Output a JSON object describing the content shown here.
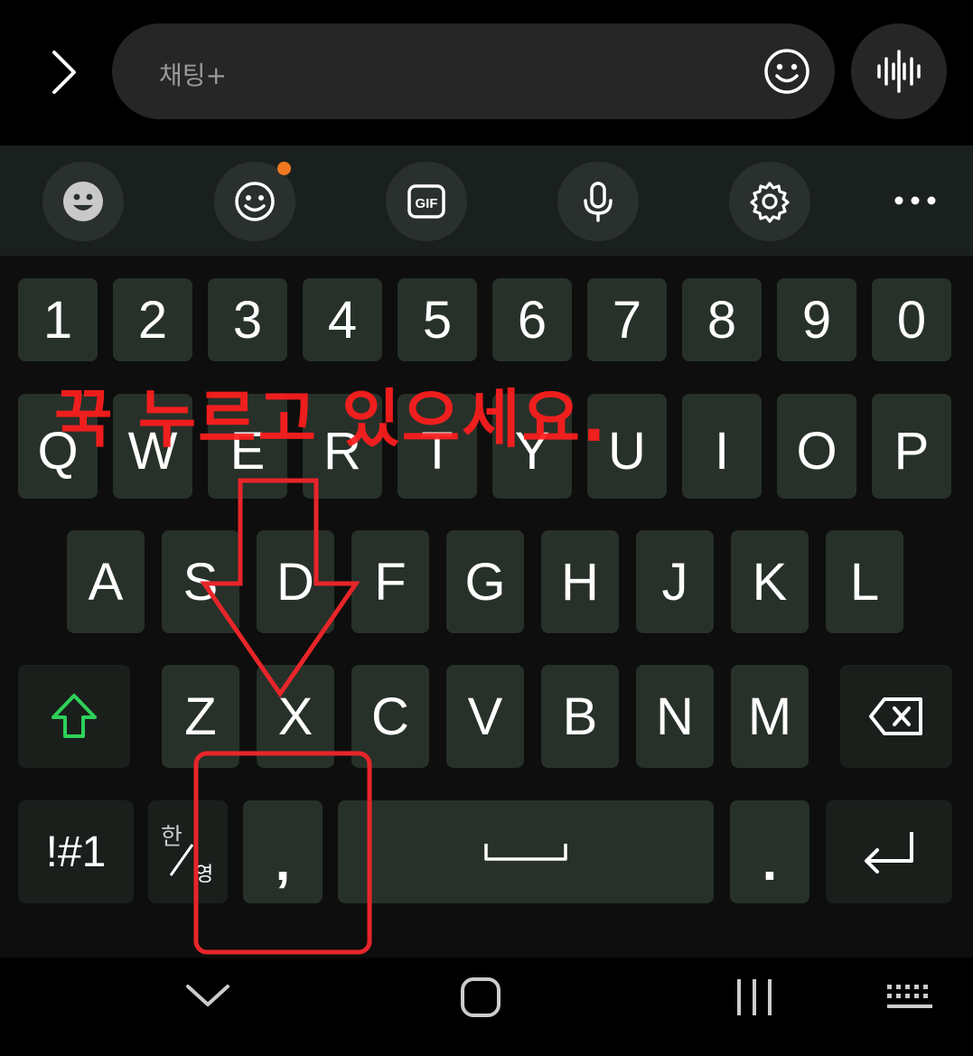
{
  "chat": {
    "placeholder": "채팅+",
    "expand_icon": "chevron-right-icon",
    "emoji_icon": "smiley-icon",
    "voice_icon": "sound-wave-icon"
  },
  "toolbar": {
    "items": [
      "emoji-face-icon",
      "sticker-icon",
      "gif-icon",
      "mic-icon",
      "gear-icon",
      "more-icon"
    ],
    "gif_label": "GIF",
    "notification_color": "#f07920"
  },
  "keyboard": {
    "numbers": [
      "1",
      "2",
      "3",
      "4",
      "5",
      "6",
      "7",
      "8",
      "9",
      "0"
    ],
    "row1": [
      "Q",
      "W",
      "E",
      "R",
      "T",
      "Y",
      "U",
      "I",
      "O",
      "P"
    ],
    "row2": [
      "A",
      "S",
      "D",
      "F",
      "G",
      "H",
      "J",
      "K",
      "L"
    ],
    "row3": [
      "Z",
      "X",
      "C",
      "V",
      "B",
      "N",
      "M"
    ],
    "symbols_label": "!#1",
    "lang_top": "한",
    "lang_bottom": "영",
    "comma": ",",
    "period": ".",
    "shift_color": "#2ed15a"
  },
  "annotation": {
    "text": "꾹 누르고 있으세요.",
    "color": "#ff1e1e"
  },
  "nav": {
    "items": [
      "back-chevron-down-icon",
      "home-icon",
      "recents-icon",
      "keyboard-switch-icon"
    ]
  }
}
